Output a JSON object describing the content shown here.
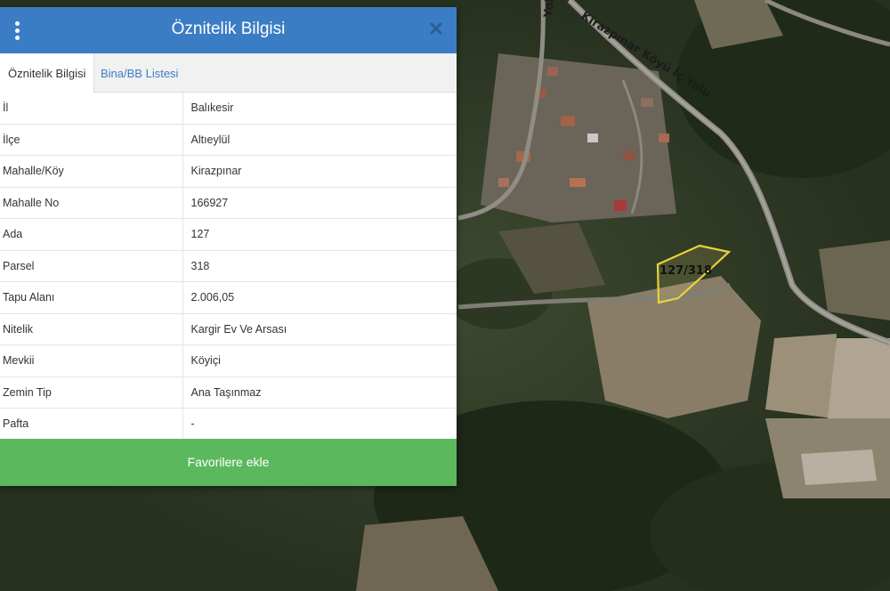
{
  "panel": {
    "title": "Öznitelik Bilgisi",
    "menu_icon": "vertical-dots-icon",
    "close_icon": "close-icon",
    "close_symbol": "✕"
  },
  "tabs": [
    {
      "label": "Öznitelik Bilgisi",
      "active": true
    },
    {
      "label": "Bina/BB Listesi",
      "active": false
    }
  ],
  "attributes": [
    {
      "key": "İl",
      "value": "Balıkesir"
    },
    {
      "key": "İlçe",
      "value": "Altıeylül"
    },
    {
      "key": "Mahalle/Köy",
      "value": "Kirazpınar"
    },
    {
      "key": "Mahalle No",
      "value": "166927"
    },
    {
      "key": "Ada",
      "value": "127"
    },
    {
      "key": "Parsel",
      "value": "318"
    },
    {
      "key": "Tapu Alanı",
      "value": "2.006,05"
    },
    {
      "key": "Nitelik",
      "value": "Kargir Ev Ve Arsası"
    },
    {
      "key": "Mevkii",
      "value": "Köyiçi"
    },
    {
      "key": "Zemin Tip",
      "value": "Ana Taşınmaz"
    },
    {
      "key": "Pafta",
      "value": "-"
    }
  ],
  "favorite_button": {
    "label": "Favorilere ekle"
  },
  "map": {
    "parcel_label": "127/318",
    "road_labels": [
      "Kirazpınar Köyü İç Yolu",
      "Yolu"
    ],
    "parcel_outline_color": "#e8d23a"
  },
  "colors": {
    "header": "#3b7dc4",
    "favorite_button": "#5cb85c",
    "tab_inactive_text": "#3b7dc4"
  }
}
